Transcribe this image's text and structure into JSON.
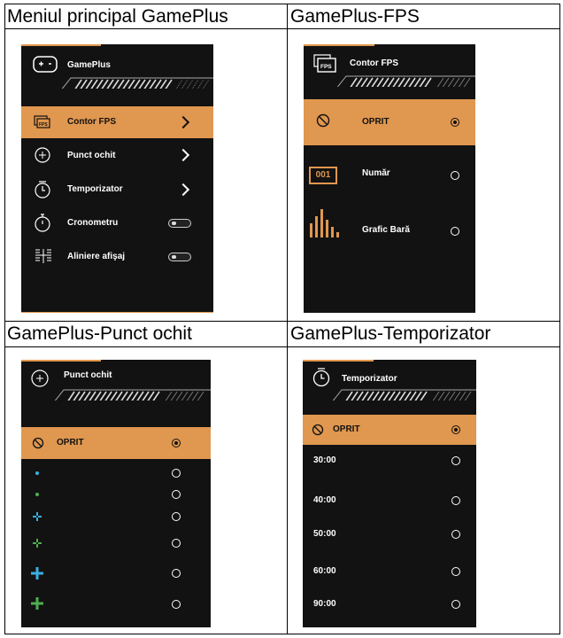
{
  "cells": {
    "main": {
      "title": "Meniul principal GamePlus"
    },
    "fps": {
      "title": "GamePlus-FPS"
    },
    "crosshair": {
      "title": "GamePlus-Punct ochit"
    },
    "timer": {
      "title": "GamePlus-Temporizator"
    }
  },
  "main_panel": {
    "header": "GamePlus",
    "items": [
      {
        "label": "Contor FPS",
        "icon": "fps-icon",
        "control": "chevron"
      },
      {
        "label": "Punct ochit",
        "icon": "crosshair-icon",
        "control": "chevron"
      },
      {
        "label": "Temporizator",
        "icon": "timer-icon",
        "control": "chevron"
      },
      {
        "label": "Cronometru",
        "icon": "stopwatch-icon",
        "control": "toggle"
      },
      {
        "label": "Aliniere afişaj",
        "icon": "alignment-icon",
        "control": "toggle"
      }
    ]
  },
  "fps_panel": {
    "header": "Contor FPS",
    "items": [
      {
        "label": "OPRIT",
        "selected": true
      },
      {
        "label": "Număr",
        "badge": "001",
        "selected": false
      },
      {
        "label": "Grafic Bară",
        "selected": false
      }
    ]
  },
  "crosshair_panel": {
    "header": "Punct ochit",
    "off_label": "OPRIT"
  },
  "timer_panel": {
    "header": "Temporizator",
    "items": [
      {
        "label": "OPRIT",
        "selected": true
      },
      {
        "label": "30:00",
        "selected": false
      },
      {
        "label": "40:00",
        "selected": false
      },
      {
        "label": "50:00",
        "selected": false
      },
      {
        "label": "60:00",
        "selected": false
      },
      {
        "label": "90:00",
        "selected": false
      }
    ]
  },
  "colors": {
    "accent": "#e0974f",
    "panel_bg": "#121212",
    "cyan": "#3ab0e0",
    "green": "#4caf50"
  }
}
